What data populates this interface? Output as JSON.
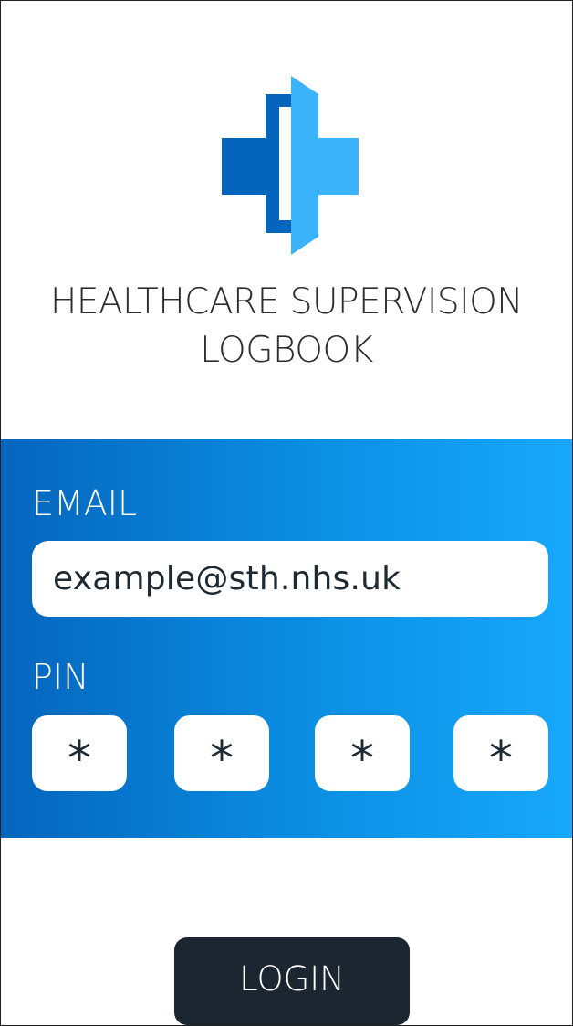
{
  "app": {
    "logo_icon": "medical-cross-icon",
    "title_line_1": "HEALTHCARE SUPERVISION",
    "title_line_2": "LOGBOOK"
  },
  "form": {
    "email_label": "EMAIL",
    "email_placeholder": "example@sth.nhs.uk",
    "pin_label": "PIN",
    "pin_digits": [
      "*",
      "*",
      "*",
      "*"
    ]
  },
  "actions": {
    "login_label": "LOGIN"
  },
  "colors": {
    "primary_dark_blue": "#0565bd",
    "primary_light_blue": "#17a8fb",
    "logo_light_blue": "#3ab3fb",
    "button_background": "#1b2631",
    "text_dark": "#2d2d2d"
  }
}
